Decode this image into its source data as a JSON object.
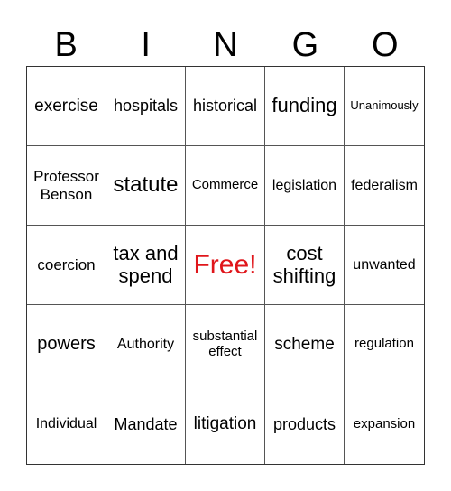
{
  "header": [
    "B",
    "I",
    "N",
    "G",
    "O"
  ],
  "free_color": "#e0161b",
  "cells": [
    "exercise",
    "hospitals",
    "historical",
    "funding",
    "Unanimously",
    "Professor Benson",
    "statute",
    "Commerce",
    "legislation",
    "federalism",
    "coercion",
    "tax and spend",
    "Free!",
    "cost shifting",
    "unwanted",
    "powers",
    "Authority",
    "substantial effect",
    "scheme",
    "regulation",
    "Individual",
    "Mandate",
    "litigation",
    "products",
    "expansion"
  ]
}
